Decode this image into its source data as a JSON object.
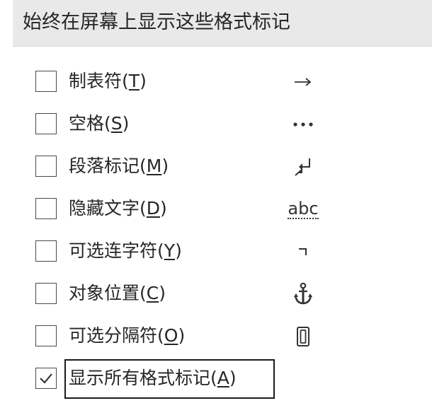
{
  "section": {
    "title": "始终在屏幕上显示这些格式标记"
  },
  "options": [
    {
      "text": "制表符",
      "key": "T",
      "checked": false,
      "symbol": "tab-arrow-icon"
    },
    {
      "text": "空格",
      "key": "S",
      "checked": false,
      "symbol": "space-dots-icon"
    },
    {
      "text": "段落标记",
      "key": "M",
      "checked": false,
      "symbol": "paragraph-mark-icon"
    },
    {
      "text": "隐藏文字",
      "key": "D",
      "checked": false,
      "symbol": "hidden-text-icon",
      "symbol_text": "abc"
    },
    {
      "text": "可选连字符",
      "key": "Y",
      "checked": false,
      "symbol": "optional-hyphen-icon"
    },
    {
      "text": "对象位置",
      "key": "C",
      "checked": false,
      "symbol": "anchor-icon"
    },
    {
      "text": "可选分隔符",
      "key": "O",
      "checked": false,
      "symbol": "optional-break-icon"
    },
    {
      "text": "显示所有格式标记",
      "key": "A",
      "checked": true,
      "symbol": ""
    }
  ],
  "colors": {
    "header_bg": "#e9e9e9",
    "text": "#262626",
    "checkmark": "#2b2b2b"
  }
}
